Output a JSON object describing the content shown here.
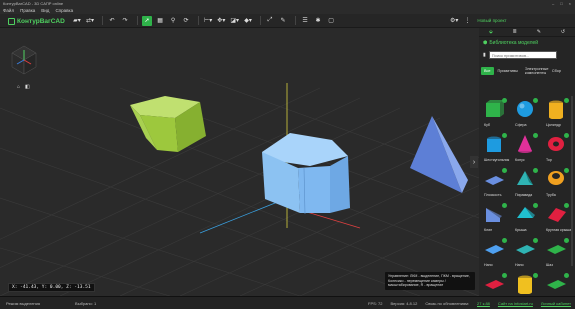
{
  "window": {
    "title": "КонтурВагCAD - 3D САПР online"
  },
  "menu": [
    "Файл",
    "Правка",
    "Вид",
    "Справка"
  ],
  "brand": "КонтурВагCAD",
  "toolbar": {
    "new_project_label": "Новый проект"
  },
  "viewport": {
    "coords_readout": "X: -41.43, Y: 0.00, Z: -13.51",
    "hint_text": "Управление: ЛКМ - выделение, ПКМ - вращение, Колесико - перемещение камеры / масштабирование, R - вращение",
    "objects": [
      {
        "shape": "hexagonal-prism",
        "color": "#9dc83d"
      },
      {
        "shape": "hexagonal-prism",
        "color": "#7fb8f0"
      },
      {
        "shape": "tetrahedron",
        "color": "#6a8fe0"
      }
    ]
  },
  "status": {
    "mode": "Режим выделения",
    "selected": "Выбрано: 1",
    "fps": "FPS: 72",
    "version": "Версия: 4.8.12",
    "feedback": "Связь по обновлениям:",
    "link1": "27 к.88",
    "link2": "Сайт на Infostart.ru",
    "link3": "Личный кабинет"
  },
  "panel": {
    "title": "Библиотека моделей",
    "search_placeholder": "Поиск примитивов...",
    "categories": [
      {
        "label": "Все",
        "active": true
      },
      {
        "label": "Примитивы",
        "active": false
      },
      {
        "label": "Электронные компоненты",
        "active": false
      },
      {
        "label": "Сбор",
        "active": false
      }
    ],
    "items": [
      {
        "label": "Куб",
        "color": "#2fb34a",
        "shape": "cube"
      },
      {
        "label": "Сфера",
        "color": "#1e9be0",
        "shape": "sphere"
      },
      {
        "label": "Цилиндр",
        "color": "#f0b020",
        "shape": "cylinder"
      },
      {
        "label": "Шестиугольник",
        "color": "#1e9be0",
        "shape": "hexcyl"
      },
      {
        "label": "Конус",
        "color": "#e0309a",
        "shape": "cone"
      },
      {
        "label": "Тор",
        "color": "#e02040",
        "shape": "torus"
      },
      {
        "label": "Плоскость",
        "color": "#6a8fe0",
        "shape": "plane"
      },
      {
        "label": "Пирамида",
        "color": "#2fb3b3",
        "shape": "pyramid"
      },
      {
        "label": "Труба",
        "color": "#f0a020",
        "shape": "tube"
      },
      {
        "label": "Клин",
        "color": "#6a8fe0",
        "shape": "wedge"
      },
      {
        "label": "Крыша",
        "color": "#20c0d0",
        "shape": "roof"
      },
      {
        "label": "Круглая крыша",
        "color": "#e02040",
        "shape": "roundroof"
      },
      {
        "label": "Нано",
        "color": "#4fa0f0",
        "shape": "flat"
      },
      {
        "label": "Нано",
        "color": "#2fb3b3",
        "shape": "flat"
      },
      {
        "label": "Шаз",
        "color": "#2fb34a",
        "shape": "flat"
      },
      {
        "label": "",
        "color": "#e02040",
        "shape": "flat"
      },
      {
        "label": "",
        "color": "#f0c020",
        "shape": "cylinder"
      },
      {
        "label": "",
        "color": "#2fb34a",
        "shape": "flat"
      }
    ]
  }
}
